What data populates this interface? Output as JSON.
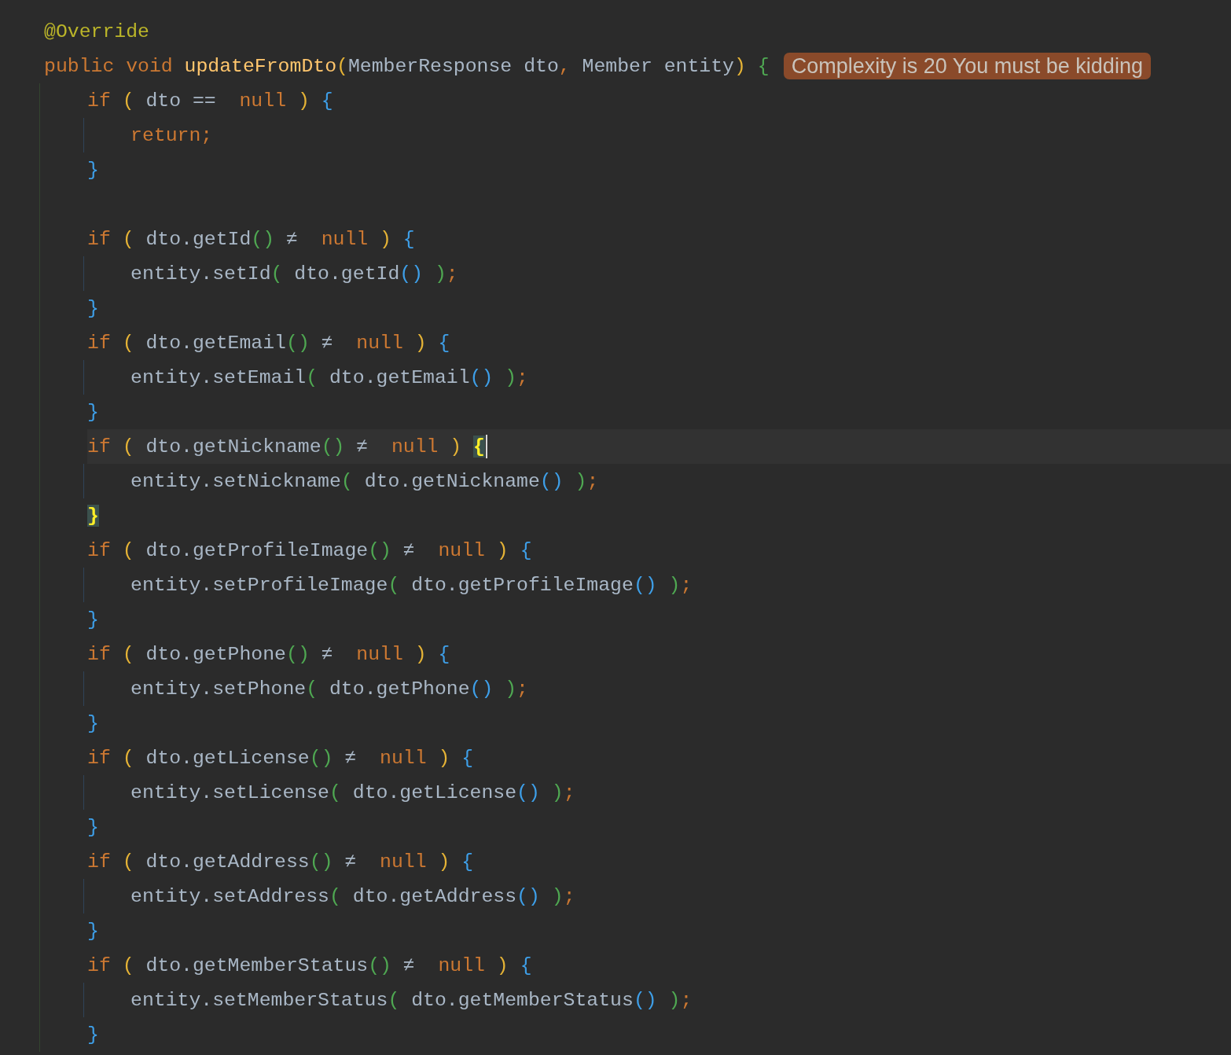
{
  "editor": {
    "lines": [
      {
        "kind": "code",
        "current": false,
        "tokens": [
          {
            "kind": "annotation",
            "text": "@Override"
          }
        ]
      },
      {
        "kind": "code",
        "current": false,
        "tokens": [
          {
            "kind": "keyword",
            "text": "public void "
          },
          {
            "kind": "method_decl",
            "text": "updateFromDto"
          },
          {
            "kind": "bracket_1",
            "text": "("
          },
          {
            "kind": "plain",
            "text": "MemberResponse dto"
          },
          {
            "kind": "punct",
            "text": ","
          },
          {
            "kind": "plain",
            "text": " Member entity"
          },
          {
            "kind": "bracket_1",
            "text": ") "
          },
          {
            "kind": "bracket_2",
            "text": "{"
          }
        ],
        "hint": "Complexity is 20 You must be kidding",
        "children": [
          {
            "kind": "code",
            "current": false,
            "tokens": [
              {
                "kind": "keyword",
                "text": "if "
              },
              {
                "kind": "bracket_1",
                "text": "( "
              },
              {
                "kind": "plain",
                "text": "dto "
              },
              {
                "kind": "operator",
                "text": "== "
              },
              {
                "kind": "keyword",
                "text": "null "
              },
              {
                "kind": "bracket_1",
                "text": ") "
              },
              {
                "kind": "bracket_3",
                "text": "{"
              }
            ],
            "children": [
              {
                "kind": "code",
                "current": false,
                "tokens": [
                  {
                    "kind": "keyword",
                    "text": "return"
                  },
                  {
                    "kind": "punct",
                    "text": ";"
                  }
                ]
              }
            ]
          },
          {
            "kind": "code",
            "current": false,
            "tokens": [
              {
                "kind": "bracket_3",
                "text": "}"
              }
            ]
          },
          {
            "kind": "blank"
          },
          {
            "kind": "code",
            "current": false,
            "tokens": [
              {
                "kind": "keyword",
                "text": "if "
              },
              {
                "kind": "bracket_1",
                "text": "( "
              },
              {
                "kind": "plain",
                "text": "dto.getId"
              },
              {
                "kind": "bracket_2",
                "text": "() "
              },
              {
                "kind": "operator",
                "text": "≠ "
              },
              {
                "kind": "keyword",
                "text": "null "
              },
              {
                "kind": "bracket_1",
                "text": ") "
              },
              {
                "kind": "bracket_3",
                "text": "{"
              }
            ],
            "children": [
              {
                "kind": "code",
                "current": false,
                "tokens": [
                  {
                    "kind": "plain",
                    "text": "entity.setId"
                  },
                  {
                    "kind": "bracket_2",
                    "text": "( "
                  },
                  {
                    "kind": "plain",
                    "text": "dto.getId"
                  },
                  {
                    "kind": "bracket_3",
                    "text": "() "
                  },
                  {
                    "kind": "bracket_2",
                    "text": ")"
                  },
                  {
                    "kind": "punct",
                    "text": ";"
                  }
                ]
              }
            ]
          },
          {
            "kind": "code",
            "current": false,
            "tokens": [
              {
                "kind": "bracket_3",
                "text": "}"
              }
            ]
          },
          {
            "kind": "code",
            "current": false,
            "tokens": [
              {
                "kind": "keyword",
                "text": "if "
              },
              {
                "kind": "bracket_1",
                "text": "( "
              },
              {
                "kind": "plain",
                "text": "dto.getEmail"
              },
              {
                "kind": "bracket_2",
                "text": "() "
              },
              {
                "kind": "operator",
                "text": "≠ "
              },
              {
                "kind": "keyword",
                "text": "null "
              },
              {
                "kind": "bracket_1",
                "text": ") "
              },
              {
                "kind": "bracket_3",
                "text": "{"
              }
            ],
            "children": [
              {
                "kind": "code",
                "current": false,
                "tokens": [
                  {
                    "kind": "plain",
                    "text": "entity.setEmail"
                  },
                  {
                    "kind": "bracket_2",
                    "text": "( "
                  },
                  {
                    "kind": "plain",
                    "text": "dto.getEmail"
                  },
                  {
                    "kind": "bracket_3",
                    "text": "() "
                  },
                  {
                    "kind": "bracket_2",
                    "text": ")"
                  },
                  {
                    "kind": "punct",
                    "text": ";"
                  }
                ]
              }
            ]
          },
          {
            "kind": "code",
            "current": false,
            "tokens": [
              {
                "kind": "bracket_3",
                "text": "}"
              }
            ]
          },
          {
            "kind": "code",
            "current": true,
            "tokens": [
              {
                "kind": "keyword",
                "text": "if "
              },
              {
                "kind": "bracket_1",
                "text": "( "
              },
              {
                "kind": "plain",
                "text": "dto.getNickname"
              },
              {
                "kind": "bracket_2",
                "text": "() "
              },
              {
                "kind": "operator",
                "text": "≠ "
              },
              {
                "kind": "keyword",
                "text": "null "
              },
              {
                "kind": "bracket_1",
                "text": ") "
              },
              {
                "kind": "bracket_match",
                "text": "{"
              }
            ],
            "children": [
              {
                "kind": "code",
                "current": false,
                "tokens": [
                  {
                    "kind": "plain",
                    "text": "entity.setNickname"
                  },
                  {
                    "kind": "bracket_2",
                    "text": "( "
                  },
                  {
                    "kind": "plain",
                    "text": "dto.getNickname"
                  },
                  {
                    "kind": "bracket_3",
                    "text": "() "
                  },
                  {
                    "kind": "bracket_2",
                    "text": ")"
                  },
                  {
                    "kind": "punct",
                    "text": ";"
                  }
                ]
              }
            ]
          },
          {
            "kind": "code",
            "current": false,
            "tokens": [
              {
                "kind": "bracket_match",
                "text": "}"
              }
            ]
          },
          {
            "kind": "code",
            "current": false,
            "tokens": [
              {
                "kind": "keyword",
                "text": "if "
              },
              {
                "kind": "bracket_1",
                "text": "( "
              },
              {
                "kind": "plain",
                "text": "dto.getProfileImage"
              },
              {
                "kind": "bracket_2",
                "text": "() "
              },
              {
                "kind": "operator",
                "text": "≠ "
              },
              {
                "kind": "keyword",
                "text": "null "
              },
              {
                "kind": "bracket_1",
                "text": ") "
              },
              {
                "kind": "bracket_3",
                "text": "{"
              }
            ],
            "children": [
              {
                "kind": "code",
                "current": false,
                "tokens": [
                  {
                    "kind": "plain",
                    "text": "entity.setProfileImage"
                  },
                  {
                    "kind": "bracket_2",
                    "text": "( "
                  },
                  {
                    "kind": "plain",
                    "text": "dto.getProfileImage"
                  },
                  {
                    "kind": "bracket_3",
                    "text": "() "
                  },
                  {
                    "kind": "bracket_2",
                    "text": ")"
                  },
                  {
                    "kind": "punct",
                    "text": ";"
                  }
                ]
              }
            ]
          },
          {
            "kind": "code",
            "current": false,
            "tokens": [
              {
                "kind": "bracket_3",
                "text": "}"
              }
            ]
          },
          {
            "kind": "code",
            "current": false,
            "tokens": [
              {
                "kind": "keyword",
                "text": "if "
              },
              {
                "kind": "bracket_1",
                "text": "( "
              },
              {
                "kind": "plain",
                "text": "dto.getPhone"
              },
              {
                "kind": "bracket_2",
                "text": "() "
              },
              {
                "kind": "operator",
                "text": "≠ "
              },
              {
                "kind": "keyword",
                "text": "null "
              },
              {
                "kind": "bracket_1",
                "text": ") "
              },
              {
                "kind": "bracket_3",
                "text": "{"
              }
            ],
            "children": [
              {
                "kind": "code",
                "current": false,
                "tokens": [
                  {
                    "kind": "plain",
                    "text": "entity.setPhone"
                  },
                  {
                    "kind": "bracket_2",
                    "text": "( "
                  },
                  {
                    "kind": "plain",
                    "text": "dto.getPhone"
                  },
                  {
                    "kind": "bracket_3",
                    "text": "() "
                  },
                  {
                    "kind": "bracket_2",
                    "text": ")"
                  },
                  {
                    "kind": "punct",
                    "text": ";"
                  }
                ]
              }
            ]
          },
          {
            "kind": "code",
            "current": false,
            "tokens": [
              {
                "kind": "bracket_3",
                "text": "}"
              }
            ]
          },
          {
            "kind": "code",
            "current": false,
            "tokens": [
              {
                "kind": "keyword",
                "text": "if "
              },
              {
                "kind": "bracket_1",
                "text": "( "
              },
              {
                "kind": "plain",
                "text": "dto.getLicense"
              },
              {
                "kind": "bracket_2",
                "text": "() "
              },
              {
                "kind": "operator",
                "text": "≠ "
              },
              {
                "kind": "keyword",
                "text": "null "
              },
              {
                "kind": "bracket_1",
                "text": ") "
              },
              {
                "kind": "bracket_3",
                "text": "{"
              }
            ],
            "children": [
              {
                "kind": "code",
                "current": false,
                "tokens": [
                  {
                    "kind": "plain",
                    "text": "entity.setLicense"
                  },
                  {
                    "kind": "bracket_2",
                    "text": "( "
                  },
                  {
                    "kind": "plain",
                    "text": "dto.getLicense"
                  },
                  {
                    "kind": "bracket_3",
                    "text": "() "
                  },
                  {
                    "kind": "bracket_2",
                    "text": ")"
                  },
                  {
                    "kind": "punct",
                    "text": ";"
                  }
                ]
              }
            ]
          },
          {
            "kind": "code",
            "current": false,
            "tokens": [
              {
                "kind": "bracket_3",
                "text": "}"
              }
            ]
          },
          {
            "kind": "code",
            "current": false,
            "tokens": [
              {
                "kind": "keyword",
                "text": "if "
              },
              {
                "kind": "bracket_1",
                "text": "( "
              },
              {
                "kind": "plain",
                "text": "dto.getAddress"
              },
              {
                "kind": "bracket_2",
                "text": "() "
              },
              {
                "kind": "operator",
                "text": "≠ "
              },
              {
                "kind": "keyword",
                "text": "null "
              },
              {
                "kind": "bracket_1",
                "text": ") "
              },
              {
                "kind": "bracket_3",
                "text": "{"
              }
            ],
            "children": [
              {
                "kind": "code",
                "current": false,
                "tokens": [
                  {
                    "kind": "plain",
                    "text": "entity.setAddress"
                  },
                  {
                    "kind": "bracket_2",
                    "text": "( "
                  },
                  {
                    "kind": "plain",
                    "text": "dto.getAddress"
                  },
                  {
                    "kind": "bracket_3",
                    "text": "() "
                  },
                  {
                    "kind": "bracket_2",
                    "text": ")"
                  },
                  {
                    "kind": "punct",
                    "text": ";"
                  }
                ]
              }
            ]
          },
          {
            "kind": "code",
            "current": false,
            "tokens": [
              {
                "kind": "bracket_3",
                "text": "}"
              }
            ]
          },
          {
            "kind": "code",
            "current": false,
            "tokens": [
              {
                "kind": "keyword",
                "text": "if "
              },
              {
                "kind": "bracket_1",
                "text": "( "
              },
              {
                "kind": "plain",
                "text": "dto.getMemberStatus"
              },
              {
                "kind": "bracket_2",
                "text": "() "
              },
              {
                "kind": "operator",
                "text": "≠ "
              },
              {
                "kind": "keyword",
                "text": "null "
              },
              {
                "kind": "bracket_1",
                "text": ") "
              },
              {
                "kind": "bracket_3",
                "text": "{"
              }
            ],
            "children": [
              {
                "kind": "code",
                "current": false,
                "tokens": [
                  {
                    "kind": "plain",
                    "text": "entity.setMemberStatus"
                  },
                  {
                    "kind": "bracket_2",
                    "text": "( "
                  },
                  {
                    "kind": "plain",
                    "text": "dto.getMemberStatus"
                  },
                  {
                    "kind": "bracket_3",
                    "text": "() "
                  },
                  {
                    "kind": "bracket_2",
                    "text": ")"
                  },
                  {
                    "kind": "punct",
                    "text": ";"
                  }
                ]
              }
            ]
          },
          {
            "kind": "code",
            "current": false,
            "tokens": [
              {
                "kind": "bracket_3",
                "text": "}"
              }
            ]
          }
        ]
      }
    ]
  }
}
